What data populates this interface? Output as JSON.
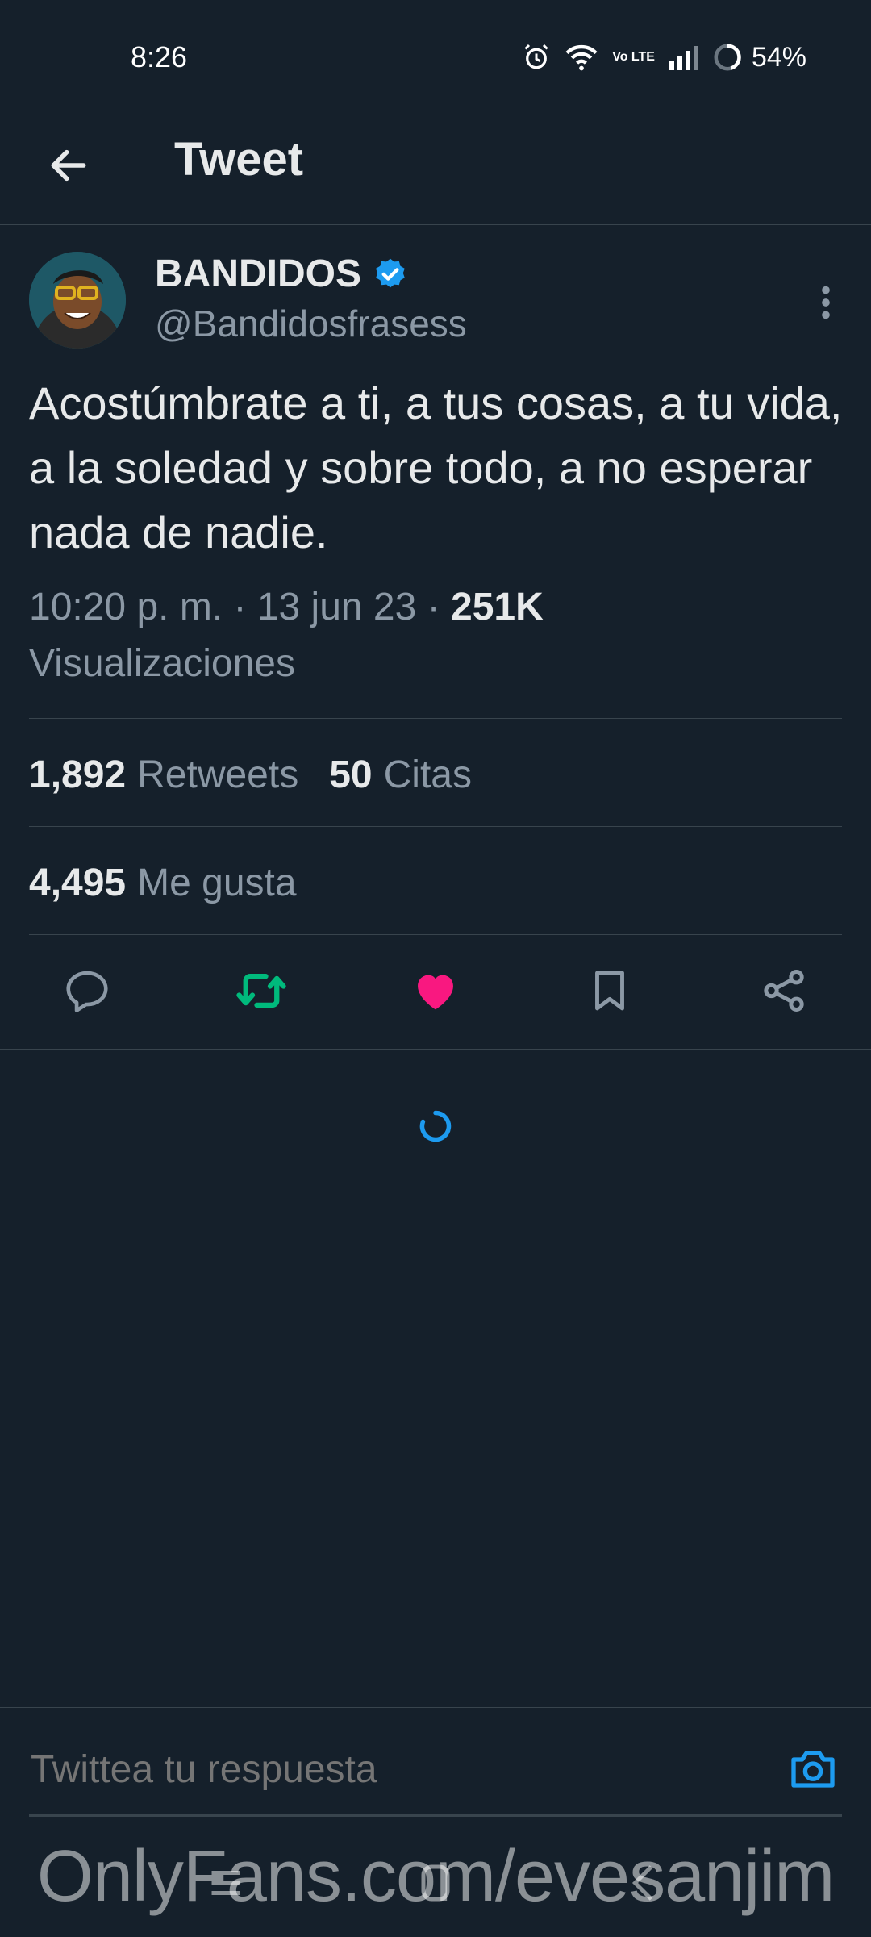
{
  "status_bar": {
    "time": "8:26",
    "battery": "54%",
    "network": "Vo LTE"
  },
  "header": {
    "title": "Tweet"
  },
  "tweet": {
    "author": {
      "display_name": "BANDIDOS",
      "handle": "@Bandidosfrasess",
      "verified": true
    },
    "text": "Acostúmbrate a ti, a tus cosas, a tu vida, a la soledad y sobre todo, a no esperar nada de nadie.",
    "time": "10:20 p. m.",
    "separator": "·",
    "date": "13 jun 23",
    "views": "251K",
    "views_label": "Visualizaciones",
    "stats": {
      "retweets_count": "1,892",
      "retweets_label": "Retweets",
      "quotes_count": "50",
      "quotes_label": "Citas",
      "likes_count": "4,495",
      "likes_label": "Me gusta"
    },
    "liked": true,
    "retweeted": true
  },
  "reply": {
    "placeholder": "Twittea tu respuesta"
  },
  "watermark": "OnlyFans.com/evesanjim",
  "colors": {
    "background": "#15202b",
    "accent": "#1d9bf0",
    "like": "#f91880",
    "retweet": "#00ba7c",
    "muted": "#8b98a5",
    "divider": "#38444d"
  },
  "icons": [
    "back-arrow-icon",
    "verified-badge-icon",
    "more-vertical-icon",
    "reply-icon",
    "retweet-icon",
    "like-icon",
    "bookmark-icon",
    "share-icon",
    "camera-icon",
    "loading-spinner-icon"
  ]
}
